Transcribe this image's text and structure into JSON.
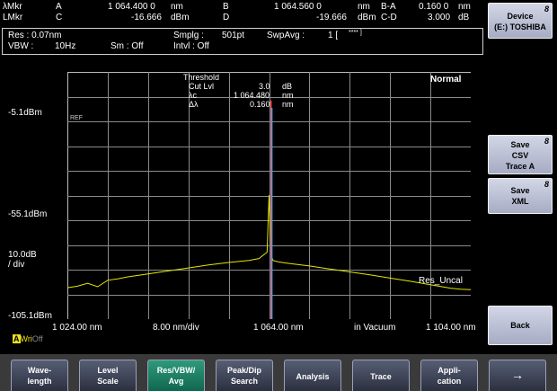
{
  "markers": {
    "row1": {
      "label": "λMkr",
      "a": "A",
      "a_val": "1 064.400 0",
      "a_unit": "nm",
      "b": "B",
      "b_val": "1 064.560 0",
      "b_unit": "nm",
      "diff": "B-A",
      "diff_val": "0.160 0",
      "diff_unit": "nm"
    },
    "row2": {
      "label": "LMkr",
      "a": "C",
      "a_val": "-16.666",
      "a_unit": "dBm",
      "b": "D",
      "b_val": "-19.666",
      "b_unit": "dBm",
      "diff": "C-D",
      "diff_val": "3.000",
      "diff_unit": "dB"
    }
  },
  "settings": {
    "res": "Res : 0.07nm",
    "vbw_label": "VBW :",
    "vbw_val": "10Hz",
    "sm": "Sm : Off",
    "smplg_label": "Smplg :",
    "smplg_val": "501pt",
    "intvl": "Intvl : Off",
    "swpavg_label": "SwpAvg :",
    "swpavg_val": "1 [",
    "swpavg_tail": "**** ]"
  },
  "threshold": {
    "title": "Threshold",
    "cut_label": "Cut Lvl",
    "cut_val": "3.0",
    "cut_unit": "dB",
    "lc_label": "λc",
    "lc_val": "1 064.480",
    "lc_unit": "nm",
    "dl_label": "Δλ",
    "dl_val": "0.160",
    "dl_unit": "nm"
  },
  "plot": {
    "mode": "Normal",
    "ref": "REF",
    "res_uncal": "Res_Uncal",
    "y_top": "-5.1dBm",
    "y_mid": "-55.1dBm",
    "y_scale1": "10.0dB",
    "y_scale2": "/ div",
    "y_bottom": "-105.1dBm",
    "x_start": "1 024.00 nm",
    "x_div": "8.00 nm/div",
    "x_center": "1 064.00 nm",
    "x_medium": "in Vacuum",
    "x_stop": "1 104.00 nm",
    "write_a": "A",
    "write_label": "Wri",
    "write_off": "Off"
  },
  "chart_data": {
    "type": "line",
    "x_label": "nm",
    "y_label": "dBm",
    "xlim": [
      1024.0,
      1104.0
    ],
    "ylim": [
      -105.1,
      -5.1
    ],
    "series": [
      {
        "color": "#e6e600",
        "x": [
          1024,
          1026,
          1028,
          1030,
          1032,
          1034,
          1036,
          1040,
          1044,
          1048,
          1052,
          1056,
          1060,
          1062,
          1063.6,
          1064.0,
          1064.4,
          1064.8,
          1066,
          1068,
          1072,
          1076,
          1080,
          1084,
          1088,
          1092,
          1096,
          1100,
          1102,
          1104
        ],
        "y": [
          -92.4,
          -91.8,
          -90.6,
          -92.0,
          -89.4,
          -88.8,
          -88.0,
          -86.8,
          -85.6,
          -84.4,
          -83.2,
          -82.2,
          -81.4,
          -80.6,
          -78.0,
          -55.0,
          -79.5,
          -81.4,
          -82.0,
          -82.6,
          -83.6,
          -84.8,
          -86.0,
          -87.2,
          -88.5,
          -89.8,
          -91.2,
          -92.6,
          -93.0,
          -93.2
        ]
      }
    ],
    "peak_markers": [
      {
        "x": 1064.4,
        "y": -16.666,
        "color": "#ff3a3a"
      },
      {
        "x": 1064.56,
        "y": -19.666,
        "color": "#3ab0ff"
      }
    ]
  },
  "right_panel": {
    "device": {
      "l1": "Device",
      "l2": "(E:) TOSHIBA"
    },
    "save_csv": {
      "l1": "Save",
      "l2": "CSV",
      "l3": "Trace A"
    },
    "save_xml": {
      "l1": "Save",
      "l2": "XML"
    },
    "back": "Back",
    "badge": "8"
  },
  "softkeys": [
    {
      "l1": "Wave-",
      "l2": "length"
    },
    {
      "l1": "Level",
      "l2": "Scale"
    },
    {
      "l1": "Res/VBW/",
      "l2": "Avg"
    },
    {
      "l1": "Peak/Dip",
      "l2": "Search"
    },
    {
      "l1": "Analysis",
      "l2": ""
    },
    {
      "l1": "Trace",
      "l2": ""
    },
    {
      "l1": "Appli-",
      "l2": "cation"
    },
    {
      "l1": "→",
      "l2": ""
    }
  ]
}
